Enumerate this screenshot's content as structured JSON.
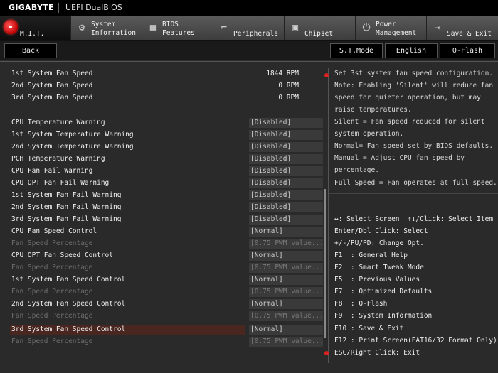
{
  "header": {
    "brand": "GIGABYTE",
    "title": "UEFI DualBIOS"
  },
  "tabs": [
    {
      "label": "M.I.T.",
      "icon": "mit-icon",
      "active": true
    },
    {
      "label": "System\nInformation",
      "icon": "gear-icon"
    },
    {
      "label": "BIOS\nFeatures",
      "icon": "bios-features-icon"
    },
    {
      "label": "Peripherals",
      "icon": "peripherals-icon"
    },
    {
      "label": "Chipset",
      "icon": "chipset-icon"
    },
    {
      "label": "Power\nManagement",
      "icon": "power-icon"
    },
    {
      "label": "Save & Exit",
      "icon": "exit-icon"
    }
  ],
  "toolbar": {
    "back": "Back",
    "st_mode": "S.T.Mode",
    "language": "English",
    "qflash": "Q-Flash"
  },
  "fan_speeds": [
    {
      "label": "1st System Fan Speed",
      "value": "1844 RPM"
    },
    {
      "label": "2nd System Fan Speed",
      "value": "0 RPM"
    },
    {
      "label": "3rd System Fan Speed",
      "value": "0 RPM"
    }
  ],
  "settings": [
    {
      "label": "CPU Temperature Warning",
      "value": "[Disabled]",
      "dim": false
    },
    {
      "label": "1st System Temperature Warning",
      "value": "[Disabled]",
      "dim": false
    },
    {
      "label": "2nd System Temperature Warning",
      "value": "[Disabled]",
      "dim": false
    },
    {
      "label": "PCH Temperature Warning",
      "value": "[Disabled]",
      "dim": false
    },
    {
      "label": "CPU Fan Fail Warning",
      "value": "[Disabled]",
      "dim": false
    },
    {
      "label": "CPU OPT Fan Fail Warning",
      "value": "[Disabled]",
      "dim": false
    },
    {
      "label": "1st System Fan Fail Warning",
      "value": "[Disabled]",
      "dim": false
    },
    {
      "label": "2nd System Fan Fail Warning",
      "value": "[Disabled]",
      "dim": false
    },
    {
      "label": "3rd System Fan Fail Warning",
      "value": "[Disabled]",
      "dim": false
    },
    {
      "label": "CPU Fan Speed Control",
      "value": "[Normal]",
      "dim": false
    },
    {
      "label": "Fan Speed Percentage",
      "value": "[0.75 PWM value...]",
      "dim": true
    },
    {
      "label": "CPU OPT Fan Speed Control",
      "value": "[Normal]",
      "dim": false
    },
    {
      "label": "Fan Speed Percentage",
      "value": "[0.75 PWM value...]",
      "dim": true
    },
    {
      "label": "1st System Fan Speed Control",
      "value": "[Normal]",
      "dim": false
    },
    {
      "label": "Fan Speed Percentage",
      "value": "[0.75 PWM value...]",
      "dim": true
    },
    {
      "label": "2nd System Fan Speed Control",
      "value": "[Normal]",
      "dim": false
    },
    {
      "label": "Fan Speed Percentage",
      "value": "[0.75 PWM value...]",
      "dim": true
    },
    {
      "label": "3rd System Fan Speed Control",
      "value": "[Normal]",
      "dim": false,
      "selected": true
    },
    {
      "label": "Fan Speed Percentage",
      "value": "[0.75 PWM value...]",
      "dim": true
    }
  ],
  "help_text": [
    "Set 3st system fan speed configuration.",
    "Note: Enabling 'Silent' will reduce fan",
    "speed for quieter operation, but may",
    "raise temperatures.",
    "Silent = Fan speed reduced for silent",
    "system operation.",
    "Normal= Fan speed set by BIOS defaults.",
    "Manual = Adjust CPU fan speed by",
    "percentage.",
    "Full Speed = Fan operates at full speed."
  ],
  "key_help": [
    "↔: Select Screen  ↑↓/Click: Select Item",
    "Enter/Dbl Click: Select",
    "+/-/PU/PD: Change Opt.",
    "F1  : General Help",
    "F2  : Smart Tweak Mode",
    "F5  : Previous Values",
    "F7  : Optimized Defaults",
    "F8  : Q-Flash",
    "F9  : System Information",
    "F10 : Save & Exit",
    "F12 : Print Screen(FAT16/32 Format Only)",
    "ESC/Right Click: Exit"
  ],
  "colors": {
    "accent_red": "#cc0000",
    "selected_row": "#4a2621"
  }
}
